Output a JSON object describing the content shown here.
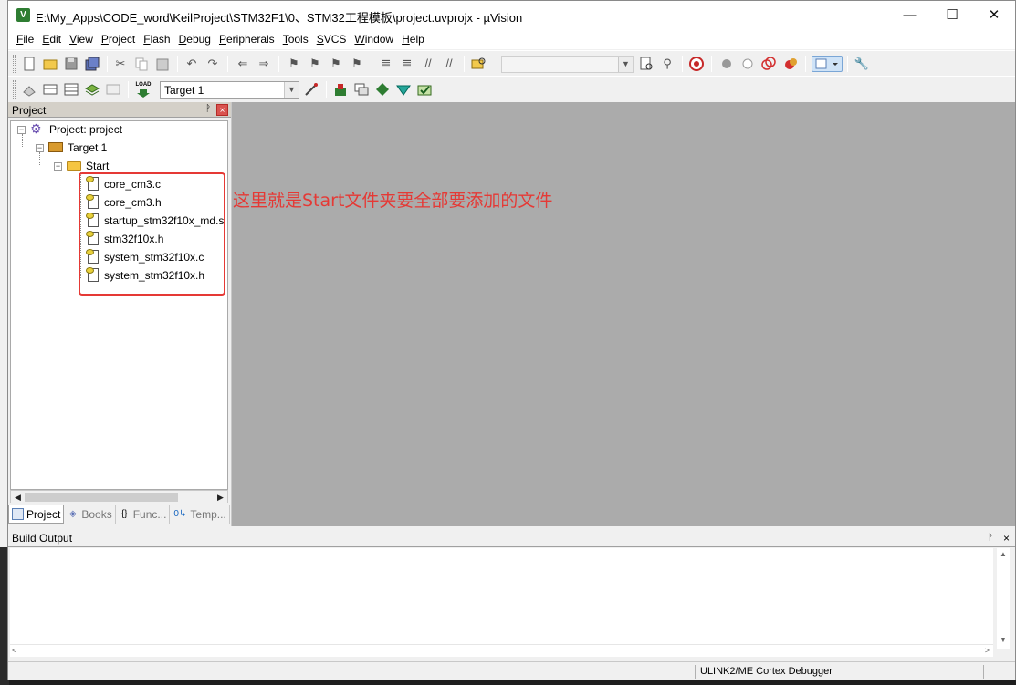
{
  "window": {
    "title": "E:\\My_Apps\\CODE_word\\KeilProject\\STM32F1\\0、STM32工程模板\\project.uvprojx - µVision",
    "app_icon": "V",
    "minimize": "—",
    "maximize": "☐",
    "close": "✕"
  },
  "menu": [
    "File",
    "Edit",
    "View",
    "Project",
    "Flash",
    "Debug",
    "Peripherals",
    "Tools",
    "SVCS",
    "Window",
    "Help"
  ],
  "toolbar2": {
    "load_label": "LOAD",
    "target_select": "Target 1"
  },
  "project_panel": {
    "title": "Project",
    "pin": "ᚹ",
    "close": "×",
    "tree": {
      "project_label": "Project: project",
      "target_label": "Target 1",
      "group_label": "Start",
      "files": [
        "core_cm3.c",
        "core_cm3.h",
        "startup_stm32f10x_md.s",
        "stm32f10x.h",
        "system_stm32f10x.c",
        "system_stm32f10x.h"
      ]
    },
    "tabs": {
      "project": "Project",
      "books": "Books",
      "functions": "Func...",
      "templates": "Temp...",
      "functions_icon": "{}",
      "templates_icon": "0↳"
    }
  },
  "annotation": {
    "text": "这里就是Start文件夹要全部要添加的文件",
    "color": "#e53935"
  },
  "build_output": {
    "title": "Build Output",
    "pin": "ᚹ",
    "close": "×"
  },
  "status_bar": {
    "debugger": "ULINK2/ME Cortex Debugger"
  }
}
